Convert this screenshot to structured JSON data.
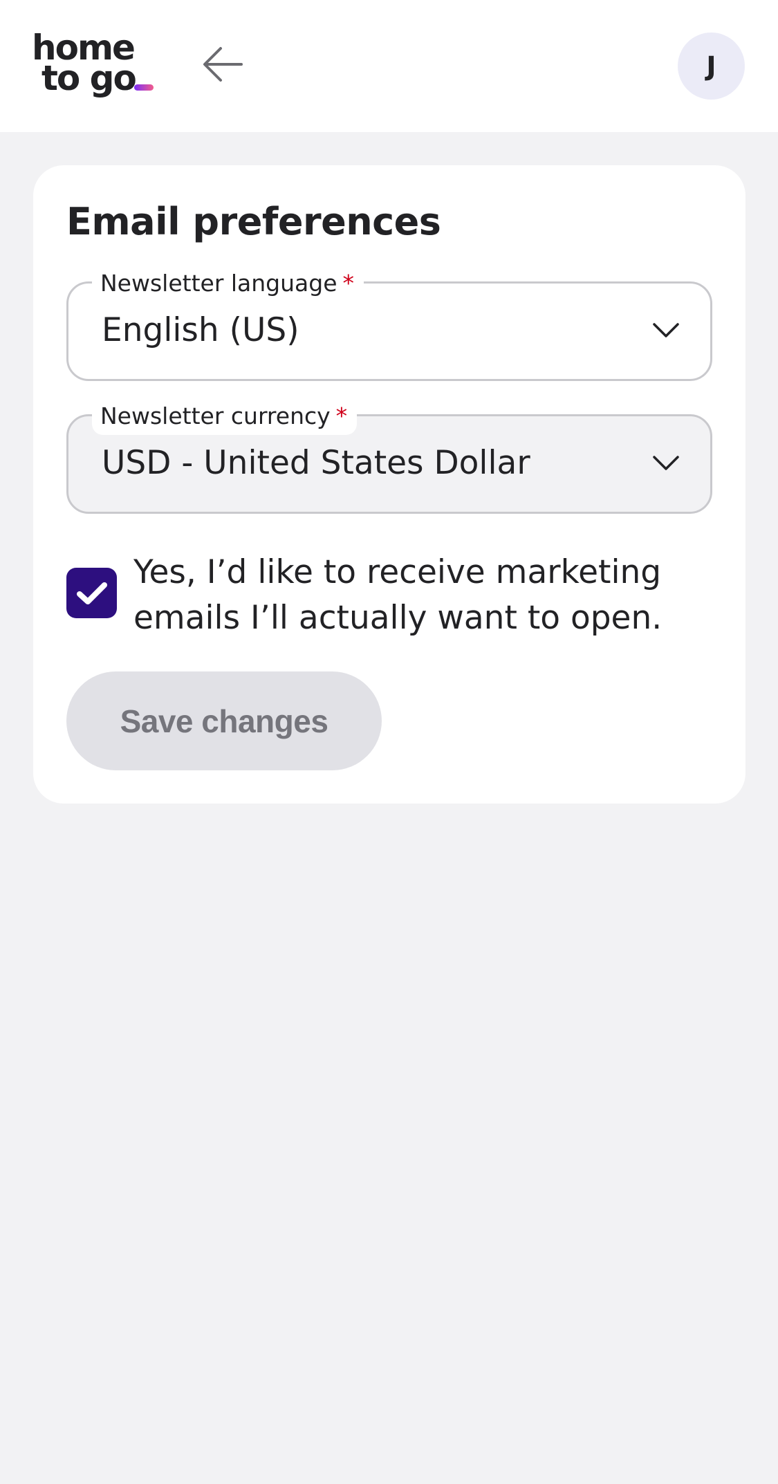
{
  "header": {
    "logo_line1": "home",
    "logo_line2": "to go",
    "logo_icon": "hometogo-logo",
    "back_icon": "arrow-left-icon",
    "avatar_initial": "J"
  },
  "colors": {
    "accent": "#2d0f7f",
    "required": "#d0021b",
    "page_bg": "#f2f2f4",
    "button_disabled_bg": "#e1e1e6",
    "button_disabled_text": "#75757c"
  },
  "card": {
    "title": "Email preferences",
    "language_field": {
      "label": "Newsletter language",
      "required_mark": "*",
      "value": "English (US)",
      "icon": "chevron-down-icon"
    },
    "currency_field": {
      "label": "Newsletter currency",
      "required_mark": "*",
      "value": "USD - United States Dollar",
      "icon": "chevron-down-icon"
    },
    "marketing_checkbox": {
      "checked": true,
      "label": "Yes, I’d like to receive marketing emails I’ll actually want to open.",
      "icon": "checkmark-icon"
    },
    "save_button": {
      "label": "Save changes",
      "disabled": true
    }
  }
}
